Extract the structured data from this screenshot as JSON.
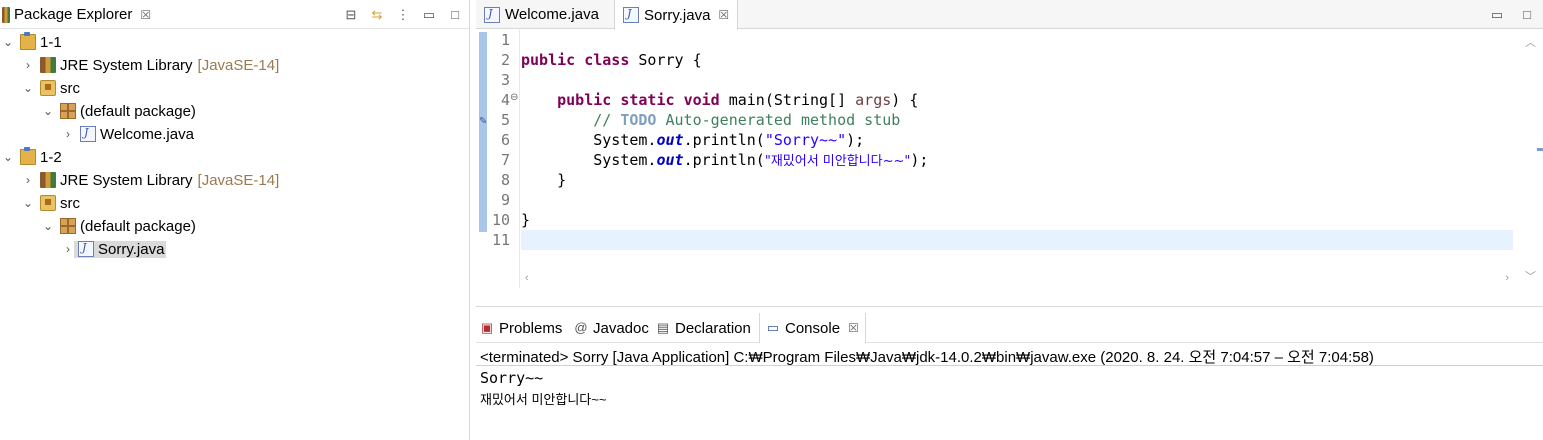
{
  "package_explorer": {
    "title": "Package Explorer",
    "close_glyph": "☒",
    "tree": [
      {
        "label": "1-1",
        "decoration": "",
        "icon": "project-icon",
        "expanded": true
      },
      {
        "label": "JRE System Library",
        "decoration": "[JavaSE-14]",
        "icon": "library-icon",
        "expanded": false
      },
      {
        "label": "src",
        "decoration": "",
        "icon": "source-folder-icon",
        "expanded": true
      },
      {
        "label": "(default package)",
        "decoration": "",
        "icon": "package-icon",
        "expanded": true
      },
      {
        "label": "Welcome.java",
        "decoration": "",
        "icon": "java-file-icon",
        "expanded": false
      },
      {
        "label": "1-2",
        "decoration": "",
        "icon": "project-icon",
        "expanded": true
      },
      {
        "label": "JRE System Library",
        "decoration": "[JavaSE-14]",
        "icon": "library-icon",
        "expanded": false
      },
      {
        "label": "src",
        "decoration": "",
        "icon": "source-folder-icon",
        "expanded": true
      },
      {
        "label": "(default package)",
        "decoration": "",
        "icon": "package-icon",
        "expanded": true
      },
      {
        "label": "Sorry.java",
        "decoration": "",
        "icon": "java-file-icon",
        "expanded": false
      }
    ]
  },
  "editor": {
    "tabs": [
      {
        "label": "Welcome.java"
      },
      {
        "label": "Sorry.java"
      }
    ],
    "line_numbers": [
      "1",
      "2",
      "3",
      "4",
      "5",
      "6",
      "7",
      "8",
      "9",
      "10",
      "11"
    ],
    "code": {
      "l2_kw1": "public",
      "l2_kw2": "class",
      "l2_rest": " Sorry {",
      "l4_kw1": "public",
      "l4_kw2": "static",
      "l4_kw3": "void",
      "l4_rest": " main(String[] ",
      "l4_param": "args",
      "l4_end": ") {",
      "l5_c1": "// ",
      "l5_todo": "TODO",
      "l5_c2": " Auto-generated method stub",
      "l6_a": "System.",
      "l6_fld": "out",
      "l6_b": ".println(",
      "l6_str": "\"Sorry~~\"",
      "l6_c": ");",
      "l7_a": "System.",
      "l7_fld": "out",
      "l7_b": ".println(",
      "l7_str": "\"재밌어서 미안합니다~~\"",
      "l7_c": ");",
      "l8": "}",
      "l10": "}"
    }
  },
  "console": {
    "tabs": [
      {
        "label": "Problems"
      },
      {
        "label": "Javadoc"
      },
      {
        "label": "Declaration"
      },
      {
        "label": "Console"
      }
    ],
    "status": "<terminated> Sorry [Java Application] C:₩Program Files₩Java₩jdk-14.0.2₩bin₩javaw.exe  (2020. 8. 24. 오전 7:04:57 – 오전 7:04:58)",
    "output": [
      "Sorry~~",
      "재밌어서 미안합니다~~"
    ]
  }
}
